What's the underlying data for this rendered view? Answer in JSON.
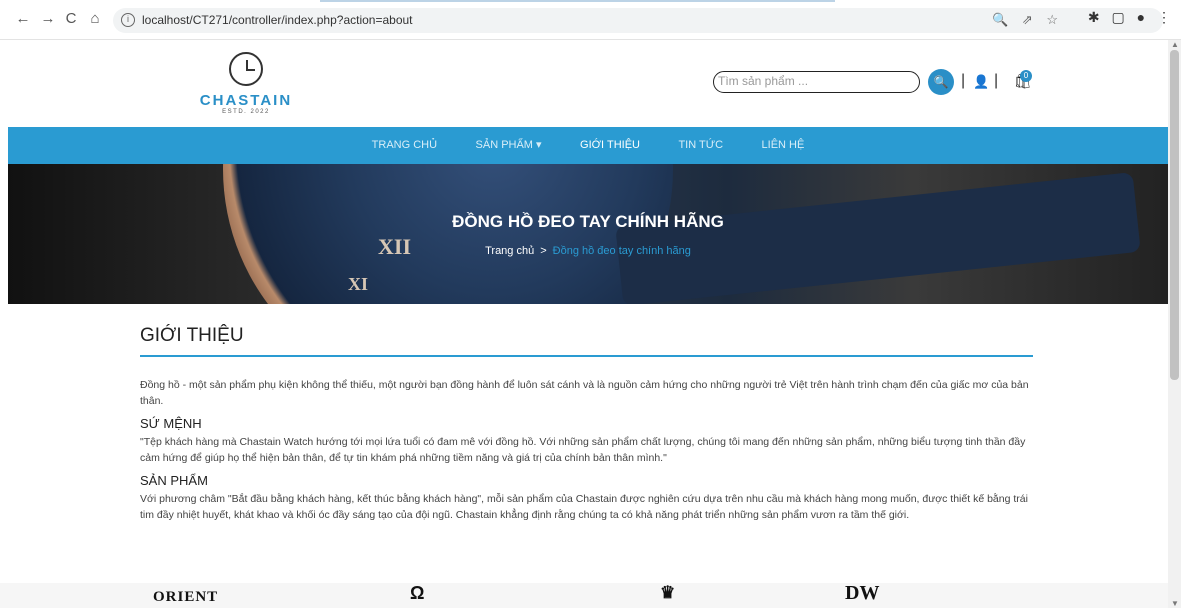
{
  "browser": {
    "url": "localhost/CT271/controller/index.php?action=about",
    "nav": {
      "back": "←",
      "forward": "→",
      "reload": "C",
      "home": "⌂"
    },
    "url_icons": [
      "🔍",
      "⇗",
      "☆"
    ],
    "ext_icons": [
      "✱",
      "▢",
      "●",
      "⋮"
    ]
  },
  "header": {
    "logo_name": "CHASTAIN",
    "logo_sub": "ESTD. 2022",
    "search_placeholder": "Tìm sản phẩm ...",
    "search_icon": "🔍",
    "separator": "|",
    "user_icon": "👤",
    "cart_icon": "🛍",
    "cart_count": "0"
  },
  "menu": [
    {
      "label": "TRANG CHỦ",
      "active": false
    },
    {
      "label": "SẢN PHẨM ▾",
      "active": false
    },
    {
      "label": "GIỚI THIỆU",
      "active": true
    },
    {
      "label": "TIN TỨC",
      "active": false
    },
    {
      "label": "LIÊN HỆ",
      "active": false
    }
  ],
  "banner": {
    "title": "ĐỒNG HỒ ĐEO TAY CHÍNH HÃNG",
    "crumb_home": "Trang chủ",
    "crumb_sep": ">",
    "crumb_current": "Đồng hồ đeo tay chính hãng"
  },
  "about": {
    "title": "GIỚI THIỆU",
    "intro": "Đồng hồ - một sản phẩm phụ kiện không thể thiếu, một người bạn đồng hành để luôn sát cánh và là nguồn cảm hứng cho những người trẻ Việt trên hành trình chạm đến của giấc mơ của bản thân.",
    "mission_title": "SỨ MỆNH",
    "mission_text": "\"Tệp khách hàng mà Chastain Watch hướng tới mọi lứa tuổi có đam mê với đồng hồ. Với những sản phẩm chất lượng, chúng tôi mang đến những sản phẩm, những biểu tượng tinh thần đầy cảm hứng để giúp họ thể hiện bản thân, để tự tin khám phá những tiềm năng và giá trị của chính bản thân mình.\"",
    "product_title": "SẢN PHẨM",
    "product_text": "Với phương châm \"Bắt đầu bằng khách hàng, kết thúc bằng khách hàng\", mỗi sản phẩm của Chastain được nghiên cứu dựa trên nhu cầu mà khách hàng mong muốn, được thiết kế bằng trái tim đầy nhiệt huyết, khát khao và khối óc đầy sáng tạo của đội ngũ. Chastain khẳng định rằng chúng ta có khả năng phát triển những sản phẩm vươn ra tầm thế giới."
  },
  "brands": [
    "ORIENT",
    "Ω",
    "♛",
    "DW"
  ],
  "colors": {
    "accent": "#2a9bd2",
    "menu_bg": "#2a9bd2"
  }
}
